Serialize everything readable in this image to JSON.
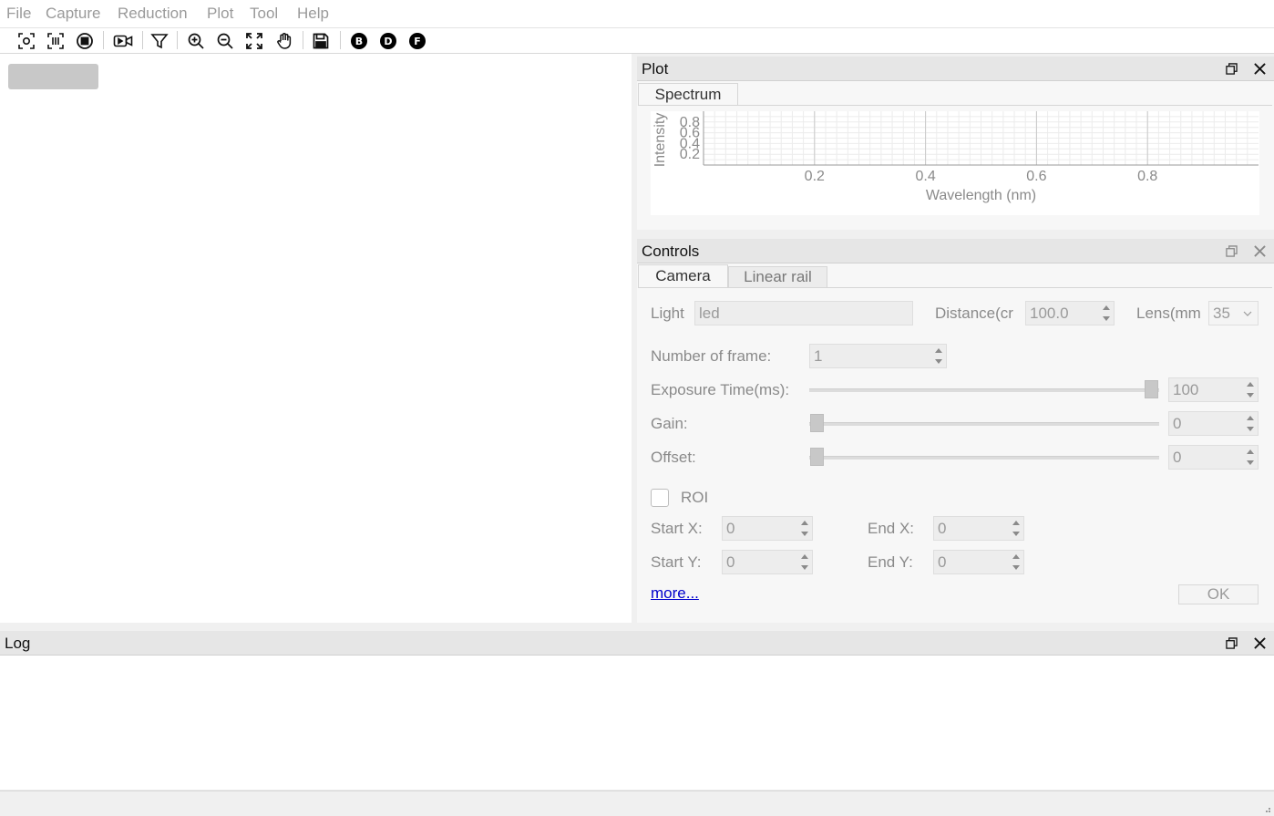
{
  "menu": [
    "File",
    "Capture",
    "Reduction",
    "Plot",
    "Tool",
    "Help"
  ],
  "toolbar": {
    "icons": [
      "capture-icon",
      "sequence-capture-icon",
      "stop-icon",
      "video-icon",
      "filter-icon",
      "zoom-in-icon",
      "zoom-out-icon",
      "fit-screen-icon",
      "pan-hand-icon",
      "save-icon"
    ],
    "circle_buttons": [
      "B",
      "D",
      "F"
    ]
  },
  "plot_panel": {
    "title": "Plot",
    "tab": "Spectrum",
    "chart_data": {
      "type": "line",
      "title": "",
      "xlabel": "Wavelength (nm)",
      "ylabel": "Intensity",
      "x_ticks": [
        "0.2",
        "0.4",
        "0.6",
        "0.8"
      ],
      "y_ticks": [
        "0.8",
        "0.6",
        "0.4",
        "0.2"
      ],
      "xlim": [
        0,
        1
      ],
      "ylim": [
        0,
        1
      ],
      "grid": true,
      "series": []
    }
  },
  "controls_panel": {
    "title": "Controls",
    "tabs": [
      "Camera",
      "Linear rail"
    ],
    "light_label": "Light",
    "light_value": "led",
    "distance_label": "Distance(cr",
    "distance_value": "100.0",
    "lens_label": "Lens(mm",
    "lens_value": "35",
    "frames_label": "Number of frame:",
    "frames_value": "1",
    "exposure_label": "Exposure Time(ms):",
    "exposure_value": "100",
    "exposure_level": 1.0,
    "gain_label": "Gain:",
    "gain_value": "0",
    "gain_level": 0.0,
    "offset_label": "Offset:",
    "offset_value": "0",
    "offset_level": 0.0,
    "roi_label": "ROI",
    "start_x_label": "Start X:",
    "start_x_value": "0",
    "end_x_label": "End X:",
    "end_x_value": "0",
    "start_y_label": "Start Y:",
    "start_y_value": "0",
    "end_y_label": "End Y:",
    "end_y_value": "0",
    "more_link": "more...",
    "ok_button": "OK"
  },
  "log_panel": {
    "title": "Log"
  }
}
